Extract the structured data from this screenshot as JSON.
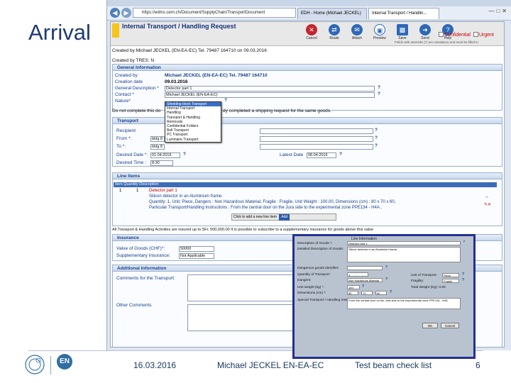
{
  "slide": {
    "title": "Arrival",
    "footer": {
      "date": "16.03.2016",
      "author": "Michael JECKEL EN-EA-EC",
      "doc_title": "Test beam check list",
      "page_number": "6"
    }
  },
  "browser": {
    "url": "https://edms.cern.ch/Document/SupplyChain/TransportDocument",
    "tabs": [
      "EDH - Home (Michael JECKEL)",
      "Internal Transport / Handlin..."
    ],
    "active_tab": 1
  },
  "app": {
    "header_title": "Internal Transport / Handling Request",
    "toolbar": [
      {
        "label": "Cancel",
        "icon": "cancel-icon",
        "color": "#c4262e"
      },
      {
        "label": "Route",
        "icon": "route-icon",
        "color": "#2d68b7"
      },
      {
        "label": "Attach",
        "icon": "attach-icon",
        "color": "#2d68b7"
      },
      {
        "label": "Preview",
        "icon": "preview-icon",
        "color": "#2d68b7"
      },
      {
        "label": "Save",
        "icon": "save-icon",
        "color": "#2d68b7"
      },
      {
        "label": "Send",
        "icon": "send-icon",
        "color": "#2d68b7"
      },
      {
        "label": "Help",
        "icon": "help-icon",
        "color": "#2d68b7"
      }
    ],
    "confidential_label": "Confidential",
    "urgent_label": "Urgent",
    "mandatory_note": "Fields with asterisks (*) are mandatory and must be filled in",
    "created_by_line": "Created by  Michael JECKEL (EN-EA-EC)  Tel. 79487 164710  on 09.03.2016",
    "created_by_tres": "Created by TRES: N",
    "general": {
      "heading": "General Information",
      "created_by_label": "Created by",
      "created_by_value": "Michael JECKEL (EN-EA-EC)  Tel. 79487 164710",
      "creation_date_label": "Creation date",
      "creation_date_value": "09.03.2016",
      "general_desc_label": "General Description *",
      "general_desc_value": "Detector part 1",
      "contact_label": "Contact *",
      "contact_value": "Michael JECKEL (EN-EA-EC)",
      "nature_label": "Nature*",
      "nature_options": [
        "Shielding block Transport",
        "Internal Transport",
        "Handling",
        "Transport & Handling",
        "Removals",
        "Confidential Folders",
        "Bell Transport",
        "PC Transport",
        "Luminaire Transport"
      ],
      "nature_selected": 0,
      "note_prefix": "Do not complete this do",
      "note_suffix": "dy completed a shipping request for the same goods."
    },
    "transport": {
      "heading": "Transport",
      "recipient_label": "Recipient",
      "from_label": "From *:",
      "from_value": "bldg 8",
      "to_label": "To *:",
      "to_value": "bldg 8",
      "desired_date_label": "Desired Date *:",
      "desired_date_value": "01.04.2016",
      "latest_date_label": "Latest Date",
      "latest_date_value": "08.04.2016",
      "desired_time_label": "Desired Time :",
      "desired_time_value": "8:30"
    },
    "line_items": {
      "heading": "Line Items",
      "columns": "Item  Quantity  Description",
      "row_item": "1",
      "row_qty": "1",
      "row_title": "Detector part 1",
      "row_sub": "Silicon detector in an Aluminium frame.",
      "row_line1": "Quantity: 1, Unit: Piece, Dangers : Non Hazardous Material, Fragile : Fragile, Unit Weight : 100.00, Dimensions (cm) : 80 x 70 x 60,",
      "row_line2": "Particular Transport/Handling Instructions : From the central door on the Jura side to the experimental zone PPE134 - H4A ,",
      "add_item_text": "Click to add a new line item",
      "add_item_button": "Add"
    },
    "insurance_note": "All Transport & Handling Activities are insured up to SFr. 500,000.00 It is possible to subscribe to a supplementary insurance for goods above this value",
    "insurance": {
      "heading": "Insurance",
      "value_label": "Value of Goods (CHF)*:",
      "value": "50000",
      "supp_label": "Supplementary Insurance:",
      "supp_value": "Not Applicable"
    },
    "additional": {
      "heading": "Additional Information",
      "comments_transport_label": "Comments for the Transport:",
      "other_comments_label": "Other Comments"
    }
  },
  "popup": {
    "title": "Line Information",
    "description_label": "Description of Goods *:",
    "description_value": "Detector part 1",
    "detailed_label": "Detailed Description of Goods:",
    "detailed_value": "Silicon detector in an Aluminium frame.",
    "dangerous_label": "Dangerous goods identifier:",
    "quantity_label": "Quantity of Transport:",
    "quantity_value": "1",
    "dangers_label": "Dangers:",
    "dangers_value": "Non Hazardous Material",
    "unit_weight_label": "Unit weight (kg) *:",
    "unit_weight_value": "100",
    "dimensions_label": "Dimensions (cm) *:",
    "dim_values": [
      "80",
      "70",
      "60"
    ],
    "instructions_label": "Special Transport / Handling Instructions:",
    "instructions_value": "From the central door on the Jura side to the experimental zone PPE134 - H4A",
    "unit_label": "Unit of Transport:",
    "unit_value": "Piece",
    "fragility_label": "Fragility:",
    "fragility_value": "Fragile",
    "total_weight": "Total Weight (Kg): 0.00",
    "ok_label": "OK",
    "cancel_label": "Cancel"
  }
}
